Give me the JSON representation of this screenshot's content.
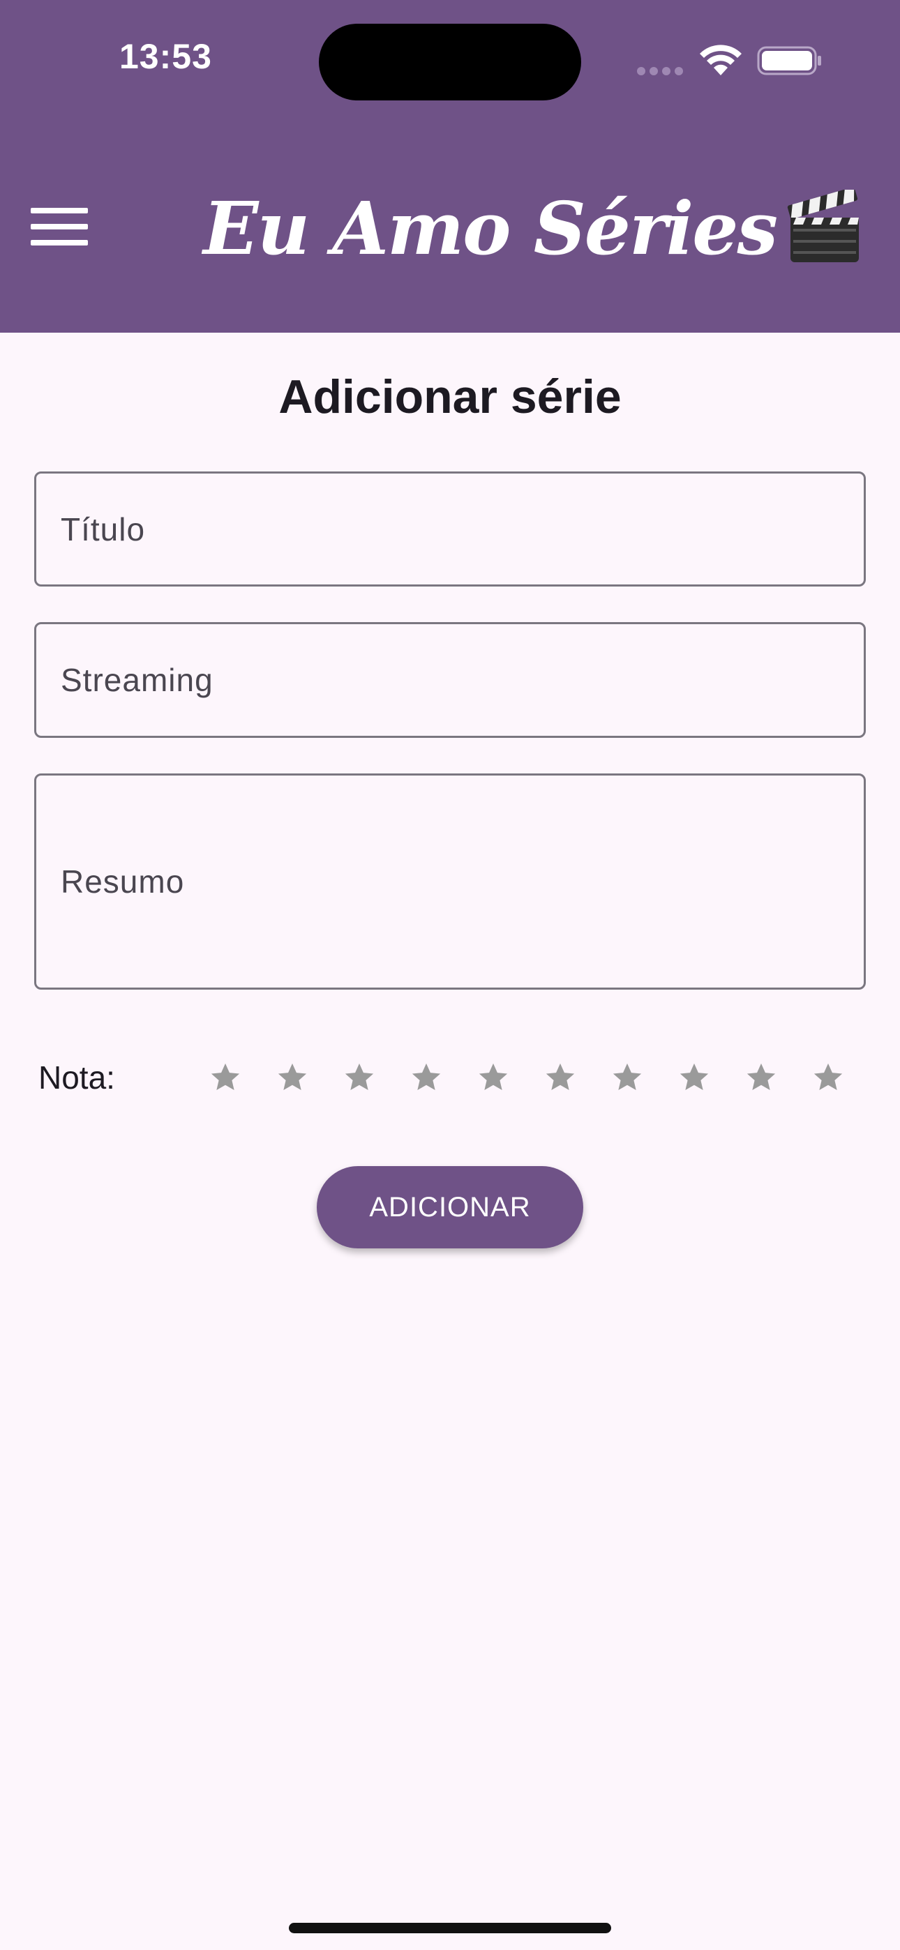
{
  "status_bar": {
    "time": "13:53"
  },
  "header": {
    "title": "Eu Amo Séries",
    "bg_color": "#6f5287",
    "menu_icon": "hamburger-menu-icon",
    "title_icon": "clapperboard-icon"
  },
  "form": {
    "title": "Adicionar série",
    "fields": [
      {
        "placeholder": "Título"
      },
      {
        "placeholder": "Streaming"
      },
      {
        "placeholder": "Resumo"
      }
    ],
    "rating": {
      "label": "Nota:",
      "max_stars": 10,
      "value": 0,
      "star_color": "#9a9a9a"
    },
    "submit_label": "ADICIONAR"
  },
  "colors": {
    "accent": "#6f5287",
    "background": "#fdf6fc"
  }
}
